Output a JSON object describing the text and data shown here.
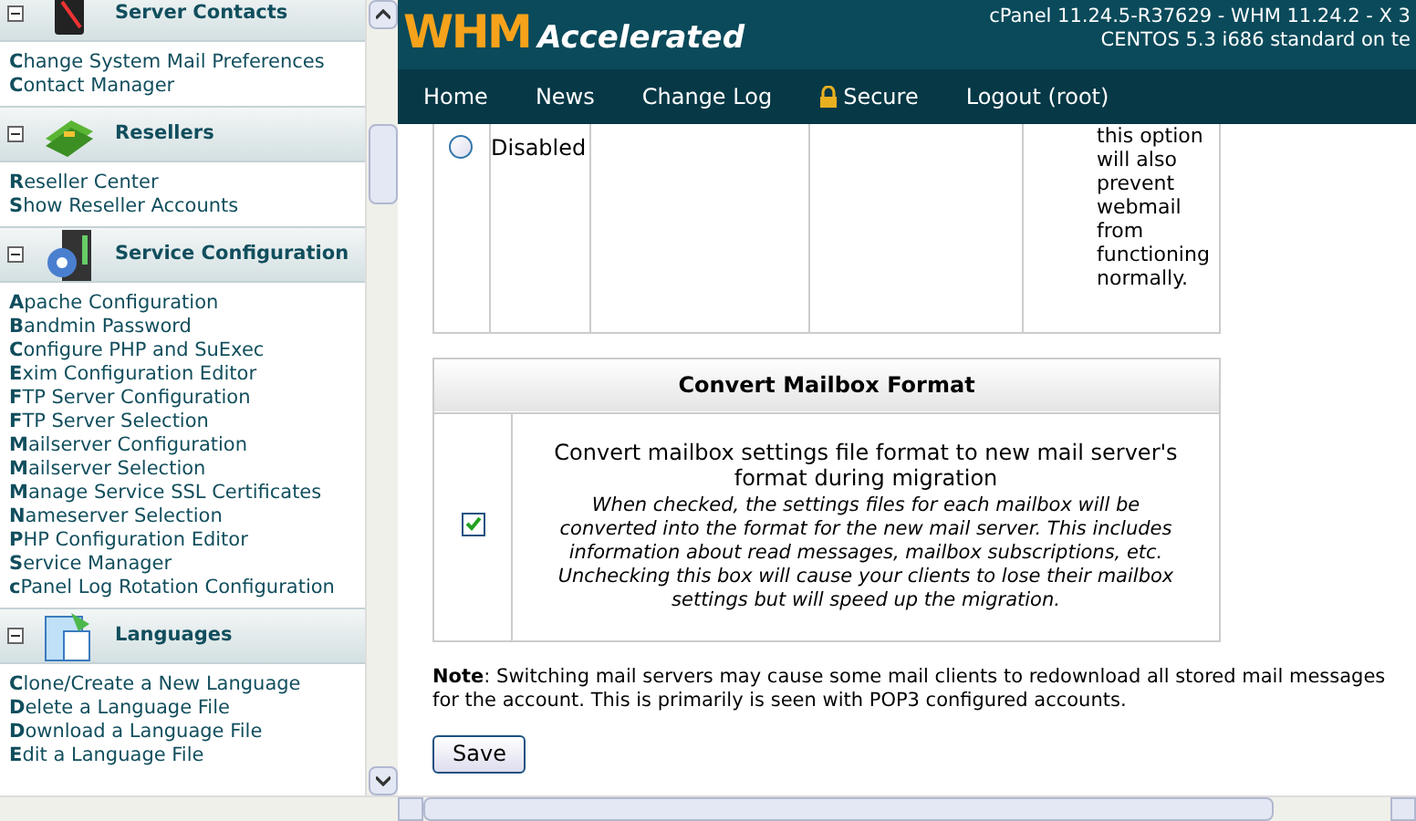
{
  "sidebar": {
    "sections": [
      {
        "title": "Server Contacts",
        "expanded": true,
        "items": [
          "**C**hange System Mail Preferences",
          "**C**ontact Manager"
        ]
      },
      {
        "title": "Resellers",
        "expanded": true,
        "items": [
          "**R**eseller Center",
          "**S**how Reseller Accounts"
        ]
      },
      {
        "title": "Service Configuration",
        "expanded": true,
        "items": [
          "**A**pache Configuration",
          "**B**andmin Password",
          "**C**onfigure PHP and SuExec",
          "**E**xim Configuration Editor",
          "**F**TP Server Configuration",
          "**F**TP Server Selection",
          "**M**ailserver Configuration",
          "**M**ailserver Selection",
          "**M**anage Service SSL Certificates",
          "**N**ameserver Selection",
          "**P**HP Configuration Editor",
          "**S**ervice Manager",
          "**c**Panel Log Rotation Configuration"
        ]
      },
      {
        "title": "Languages",
        "expanded": true,
        "items": [
          "**C**lone/Create a New Language",
          "**D**elete a Language File",
          "**D**ownload a Language File",
          "**E**dit a Language File"
        ]
      }
    ]
  },
  "header": {
    "logo": "WHM",
    "logo_suffix": "Accelerated",
    "version_lines": [
      "cPanel 11.24.5-R37629 - WHM 11.24.2 - X 3",
      "CENTOS 5.3 i686 standard on te"
    ]
  },
  "nav": [
    {
      "label": "Home",
      "kind": "link"
    },
    {
      "label": "News",
      "kind": "link"
    },
    {
      "label": "Change Log",
      "kind": "link"
    },
    {
      "label": "Secure",
      "kind": "lock"
    },
    {
      "label": "Logout (root)",
      "kind": "link"
    }
  ],
  "option_row": {
    "label": "Disabled",
    "selected": false,
    "description": "this option will also prevent webmail from functioning normally."
  },
  "convert": {
    "title": "Convert Mailbox Format",
    "checked": true,
    "label": "Convert mailbox settings file format to new mail server's format during migration",
    "help": "When checked, the settings files for each mailbox will be converted into the format for the new mail server. This includes information about read messages, mailbox subscriptions, etc. Unchecking this box will cause your clients to lose their mailbox settings but will speed up the migration."
  },
  "note": "**Note**: Switching mail servers may cause some mail clients to redownload all stored mail messages for the account. This is primarily is seen with POP3 configured accounts.",
  "save_button": "Save"
}
